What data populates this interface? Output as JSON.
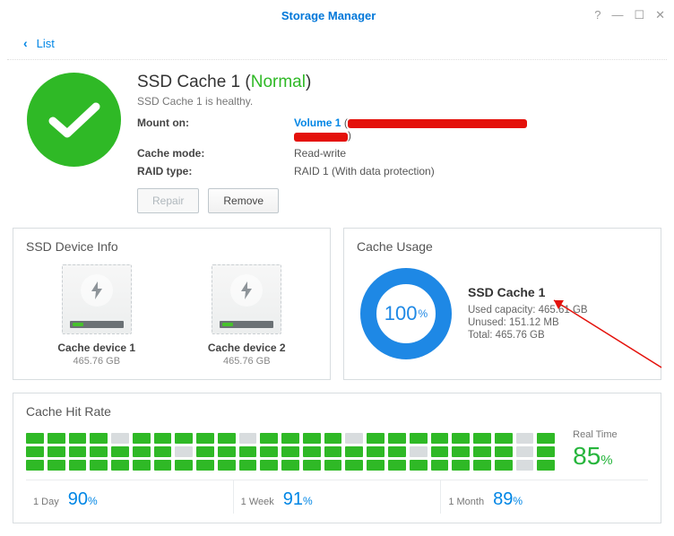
{
  "window": {
    "title": "Storage Manager",
    "back_label": "List"
  },
  "header": {
    "title_prefix": "SSD Cache 1 (",
    "status": "Normal",
    "title_suffix": ")",
    "subtitle": "SSD Cache 1 is healthy.",
    "mount_label": "Mount on:",
    "mount_value": "Volume 1",
    "cache_mode_label": "Cache mode:",
    "cache_mode_value": "Read-write",
    "raid_label": "RAID type:",
    "raid_value": "RAID 1 (With data protection)",
    "repair_btn": "Repair",
    "remove_btn": "Remove"
  },
  "device_panel": {
    "title": "SSD Device Info",
    "devices": [
      {
        "name": "Cache device 1",
        "size": "465.76 GB"
      },
      {
        "name": "Cache device 2",
        "size": "465.76 GB"
      }
    ]
  },
  "usage_panel": {
    "title": "Cache Usage",
    "percent": "100",
    "percent_suffix": "%",
    "name": "SSD Cache 1",
    "used_label": "Used capacity: 465.61 GB",
    "unused_label": "Unused: 151.12 MB",
    "total_label": "Total: 465.76 GB"
  },
  "hitrate_panel": {
    "title": "Cache Hit Rate",
    "realtime_label": "Real Time",
    "realtime_value": "85",
    "realtime_suffix": "%",
    "periods": [
      {
        "label": "1 Day",
        "value": "90",
        "suffix": "%"
      },
      {
        "label": "1 Week",
        "value": "91",
        "suffix": "%"
      },
      {
        "label": "1 Month",
        "value": "89",
        "suffix": "%"
      }
    ],
    "columns": [
      [
        1,
        1,
        1
      ],
      [
        1,
        1,
        1
      ],
      [
        1,
        1,
        1
      ],
      [
        1,
        1,
        1
      ],
      [
        0,
        1,
        1
      ],
      [
        1,
        1,
        1
      ],
      [
        1,
        1,
        1
      ],
      [
        1,
        0,
        1
      ],
      [
        1,
        1,
        1
      ],
      [
        1,
        1,
        1
      ],
      [
        0,
        1,
        1
      ],
      [
        1,
        1,
        1
      ],
      [
        1,
        1,
        1
      ],
      [
        1,
        1,
        1
      ],
      [
        1,
        1,
        1
      ],
      [
        0,
        1,
        1
      ],
      [
        1,
        1,
        1
      ],
      [
        1,
        1,
        1
      ],
      [
        1,
        0,
        1
      ],
      [
        1,
        1,
        1
      ],
      [
        1,
        1,
        1
      ],
      [
        1,
        1,
        1
      ],
      [
        1,
        1,
        1
      ],
      [
        0,
        0,
        0
      ],
      [
        1,
        1,
        1
      ]
    ]
  },
  "chart_data": {
    "type": "pie",
    "title": "Cache Usage",
    "series": [
      {
        "name": "Used",
        "value": 465.61,
        "unit": "GB"
      },
      {
        "name": "Unused",
        "value": 0.14758,
        "unit": "GB"
      }
    ],
    "center_label": "100%",
    "total": "465.76 GB"
  }
}
